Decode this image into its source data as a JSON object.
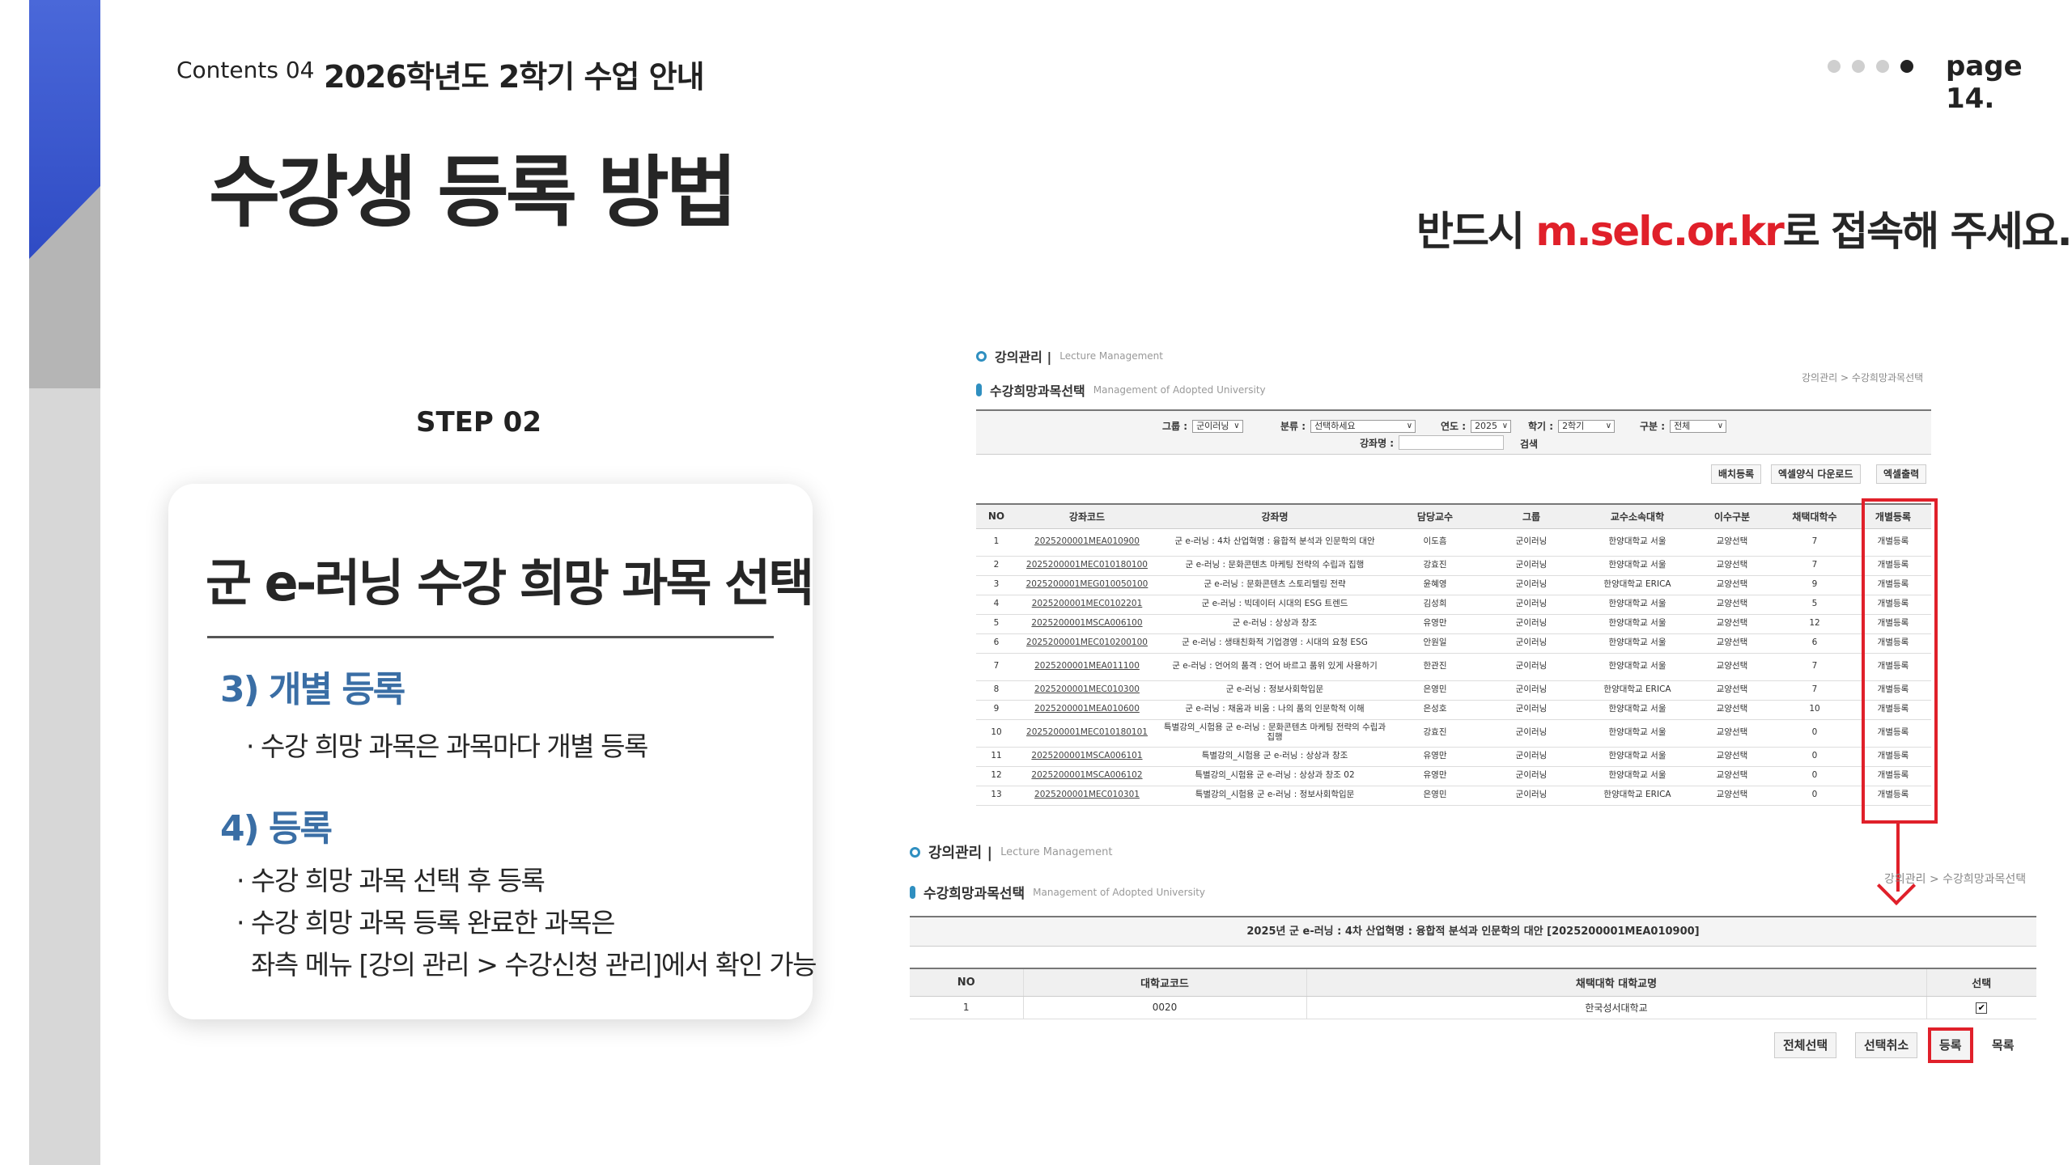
{
  "header": {
    "contents": "Contents 04",
    "title": "2026학년도 2학기 수업 안내",
    "page": "page 14."
  },
  "main_title": "수강생 등록 방법",
  "notice": {
    "before": "반드시 ",
    "url": "m.selc.or.kr",
    "after": "로 접속해 주세요."
  },
  "step": "STEP 02",
  "card": {
    "title": "군 e-러닝 수강 희망 과목 선택",
    "sections": [
      {
        "title": "3) 개별 등록",
        "lines": [
          "· 수강 희망 과목은 과목마다 개별 등록"
        ]
      },
      {
        "title": "4) 등록",
        "lines": [
          "· 수강 희망 과목 선택 후 등록",
          "· 수강 희망 과목 등록 완료한 과목은",
          "좌측 메뉴 [강의 관리 > 수강신청 관리]에서 확인 가능"
        ]
      }
    ]
  },
  "top_panel": {
    "section_label": "강의관리 |",
    "section_label_en": "Lecture Management",
    "sub_label": "수강희망과목선택",
    "sub_label_en": "Management of Adopted University",
    "breadcrumb": "강의관리 > 수강희망과목선택",
    "search": {
      "group_label": "그룹 :",
      "group_value": "군이러닝",
      "category_label": "분류 :",
      "category_value": "선택하세요",
      "year_label": "연도 :",
      "year_value": "2025",
      "semester_label": "학기 :",
      "semester_value": "2학기",
      "type_label": "구분 :",
      "type_value": "전체",
      "course_label": "강좌명 :",
      "search_button": "검색"
    },
    "buttons": [
      "배치등록",
      "엑셀양식 다운로드",
      "엑셀출력"
    ],
    "columns": [
      "NO",
      "강좌코드",
      "강좌명",
      "담당교수",
      "그룹",
      "교수소속대학",
      "이수구분",
      "채택대학수",
      "개별등록"
    ],
    "rows": [
      [
        "1",
        "2025200001MEA010900",
        "군 e-러닝 : 4차 산업혁명 : 융합적 분석과 인문학의 대안",
        "이도흠",
        "군이러닝",
        "한양대학교 서울",
        "교양선택",
        "7",
        "개별등록"
      ],
      [
        "2",
        "2025200001MEC010180100",
        "군 e-러닝 : 문화콘텐츠 마케팅 전략의 수립과 집행",
        "강효진",
        "군이러닝",
        "한양대학교 서울",
        "교양선택",
        "7",
        "개별등록"
      ],
      [
        "3",
        "2025200001MEG010050100",
        "군 e-러닝 : 문화콘텐츠 스토리텔링 전략",
        "윤혜영",
        "군이러닝",
        "한양대학교 ERICA",
        "교양선택",
        "9",
        "개별등록"
      ],
      [
        "4",
        "2025200001MEC0102201",
        "군 e-러닝 : 빅데이터 시대의 ESG 트렌드",
        "김성희",
        "군이러닝",
        "한양대학교 서울",
        "교양선택",
        "5",
        "개별등록"
      ],
      [
        "5",
        "2025200001MSCA006100",
        "군 e-러닝 : 상상과 창조",
        "유영만",
        "군이러닝",
        "한양대학교 서울",
        "교양선택",
        "12",
        "개별등록"
      ],
      [
        "6",
        "2025200001MEC010200100",
        "군 e-러닝 : 생태친화적 기업경영 : 시대의 요청 ESG",
        "안원일",
        "군이러닝",
        "한양대학교 서울",
        "교양선택",
        "6",
        "개별등록"
      ],
      [
        "7",
        "2025200001MEA011100",
        "군 e-러닝 : 언어의 품격 : 언어 바르고 품위 있게 사용하기",
        "한관진",
        "군이러닝",
        "한양대학교 서울",
        "교양선택",
        "7",
        "개별등록"
      ],
      [
        "8",
        "2025200001MEC010300",
        "군 e-러닝 : 정보사회학입문",
        "은영민",
        "군이러닝",
        "한양대학교 ERICA",
        "교양선택",
        "7",
        "개별등록"
      ],
      [
        "9",
        "2025200001MEA010600",
        "군 e-러닝 : 채움과 비움 : 나의 품의 인문학적 이해",
        "은성호",
        "군이러닝",
        "한양대학교 서울",
        "교양선택",
        "10",
        "개별등록"
      ],
      [
        "10",
        "2025200001MEC010180101",
        "특별강의_시험용 군 e-러닝 : 문화콘텐츠 마케팅 전략의 수립과 집행",
        "강효진",
        "군이러닝",
        "한양대학교 서울",
        "교양선택",
        "0",
        "개별등록"
      ],
      [
        "11",
        "2025200001MSCA006101",
        "특별강의_시험용 군 e-러닝 : 상상과 창조",
        "유영만",
        "군이러닝",
        "한양대학교 서울",
        "교양선택",
        "0",
        "개별등록"
      ],
      [
        "12",
        "2025200001MSCA006102",
        "특별강의_시험용 군 e-러닝 : 상상과 창조 02",
        "유영만",
        "군이러닝",
        "한양대학교 서울",
        "교양선택",
        "0",
        "개별등록"
      ],
      [
        "13",
        "2025200001MEC010301",
        "특별강의_시험용 군 e-러닝 : 정보사회학입문",
        "은영민",
        "군이러닝",
        "한양대학교 ERICA",
        "교양선택",
        "0",
        "개별등록"
      ]
    ]
  },
  "bottom_panel": {
    "section_label": "강의관리 |",
    "section_label_en": "Lecture Management",
    "sub_label": "수강희망과목선택",
    "sub_label_en": "Management of Adopted University",
    "breadcrumb": "강의관리 > 수강희망과목선택",
    "course_title": "2025년 군 e-러닝 : 4차 산업혁명 : 융합적 분석과 인문학의 대안 [2025200001MEA010900]",
    "columns": [
      "NO",
      "대학교코드",
      "채택대학 대학교명",
      "선택"
    ],
    "rows": [
      [
        "1",
        "0020",
        "한국성서대학교",
        "checked"
      ]
    ],
    "buttons": [
      "전체선택",
      "선택취소",
      "등록",
      "목록"
    ]
  },
  "colors": {
    "accent_red": "#e0202a",
    "section_blue": "#3a6ea5",
    "stripe_blue": "#3b57cf"
  }
}
